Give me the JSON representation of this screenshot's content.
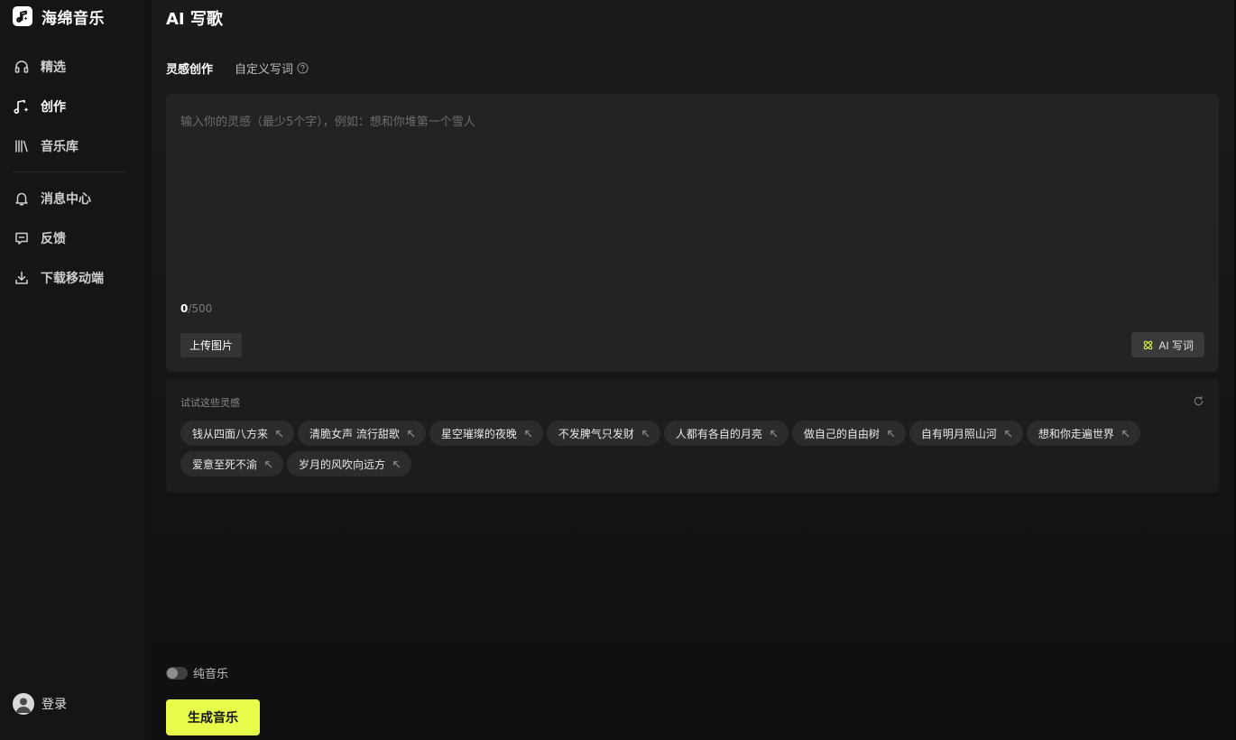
{
  "app": {
    "name": "海绵音乐"
  },
  "sidebar": {
    "items": [
      {
        "label": "精选",
        "icon": "headphones-icon"
      },
      {
        "label": "创作",
        "icon": "music-note-sparkle-icon",
        "active": true
      },
      {
        "label": "音乐库",
        "icon": "library-icon"
      },
      {
        "label": "消息中心",
        "icon": "bell-icon"
      },
      {
        "label": "反馈",
        "icon": "feedback-icon"
      },
      {
        "label": "下载移动端",
        "icon": "download-icon"
      }
    ],
    "login_label": "登录"
  },
  "main": {
    "title": "AI 写歌",
    "tabs": [
      {
        "label": "灵感创作",
        "active": true
      },
      {
        "label": "自定义写词",
        "has_help": true
      }
    ],
    "editor": {
      "placeholder": "输入你的灵感（最少5个字），例如：想和你堆第一个雪人",
      "value": "",
      "count_current": "0",
      "count_max": "/500",
      "upload_label": "上传图片",
      "ai_lyrics_label": "AI 写词"
    },
    "inspiration": {
      "title": "试试这些灵感",
      "chips": [
        "钱从四面八方来",
        "清脆女声 流行甜歌",
        "星空璀璨的夜晚",
        "不发脾气只发财",
        "人都有各自的月亮",
        "做自己的自由树",
        "自有明月照山河",
        "想和你走遍世界",
        "爱意至死不渝",
        "岁月的风吹向远方"
      ]
    },
    "pure_music_label": "纯音乐",
    "pure_music_on": false,
    "generate_label": "生成音乐"
  },
  "colors": {
    "accent": "#e6fb4a",
    "background": "#111111",
    "panel": "#232323"
  }
}
